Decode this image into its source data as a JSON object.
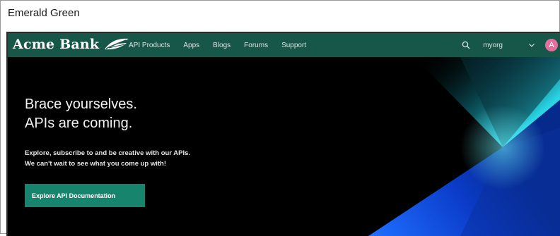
{
  "caption": "Emerald Green",
  "brand": {
    "name": "Acme Bank"
  },
  "nav": {
    "items": [
      "API Products",
      "Apps",
      "Blogs",
      "Forums",
      "Support"
    ],
    "org": "myorg",
    "avatar_initial": "A"
  },
  "hero": {
    "headline_line1": "Brace yourselves.",
    "headline_line2": "APIs are coming.",
    "sub_line1": "Explore, subscribe to and be creative with our APIs.",
    "sub_line2": "We can't wait to see what you come up with!",
    "cta": "Explore API Documentation"
  },
  "colors": {
    "navbar": "#17574a",
    "cta": "#17846e",
    "hero_background": "#000000",
    "avatar": "#e46e9b"
  },
  "icons": {
    "search": "search-icon",
    "org_menu": "chevron-down-icon",
    "logo_mark": "leaf-icon"
  }
}
